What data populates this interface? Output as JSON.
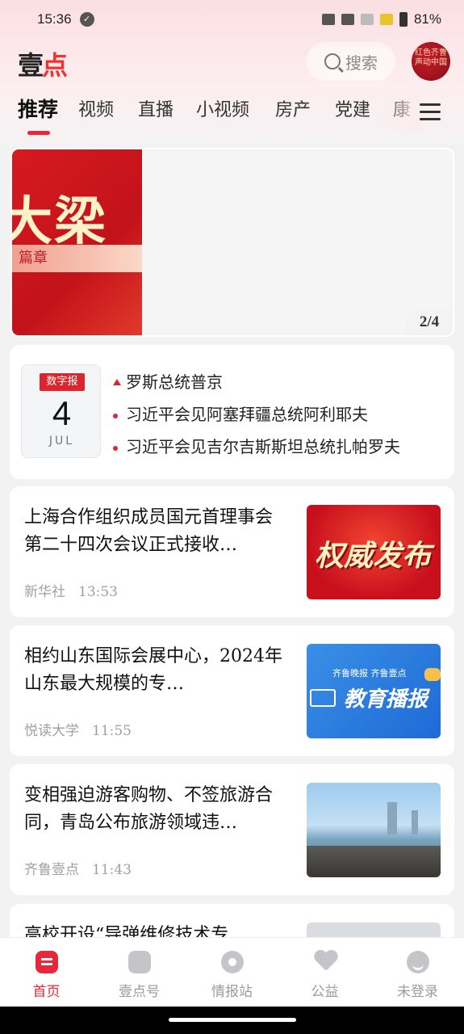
{
  "status_bar": {
    "time": "15:36",
    "battery": "81%"
  },
  "header": {
    "logo_main": "壹",
    "logo_dot": "点",
    "search_placeholder": "搜索",
    "avatar_text": "红色齐鲁 声动中国"
  },
  "tabs": [
    {
      "label": "推荐",
      "active": true
    },
    {
      "label": "视频"
    },
    {
      "label": "直播"
    },
    {
      "label": "小视频"
    },
    {
      "label": "房产"
    },
    {
      "label": "党建"
    },
    {
      "label": "康"
    }
  ],
  "banner": {
    "big_text": "大梁",
    "strip_text": "篇章",
    "counter": "2/4"
  },
  "digital_paper": {
    "label": "数字报",
    "day": "4",
    "month": "JUL",
    "headlines": [
      "罗斯总统普京",
      "习近平会见阿塞拜疆总统阿利耶夫",
      "习近平会见吉尔吉斯斯坦总统扎帕罗夫"
    ]
  },
  "news": [
    {
      "title": "上海合作组织成员国元首理事会第二十四次会议正式接收…",
      "source": "新华社",
      "time": "13:53",
      "thumb_text": "权威发布"
    },
    {
      "title": "相约山东国际会展中心，2024年山东最大规模的专…",
      "source": "悦读大学",
      "time": "11:55",
      "thumb_text": "教育播报",
      "thumb_top": "齐鲁晚报 齐鲁壹点"
    },
    {
      "title": "变相强迫游客购物、不签旅游合同，青岛公布旅游领域违…",
      "source": "齐鲁壹点",
      "time": "11:43"
    },
    {
      "title": "高校开设“导弹维修技术专"
    }
  ],
  "bottom_nav": [
    {
      "label": "首页",
      "icon": "home-icon",
      "active": true
    },
    {
      "label": "壹点号",
      "icon": "yidianhao-icon"
    },
    {
      "label": "情报站",
      "icon": "intel-station-icon"
    },
    {
      "label": "公益",
      "icon": "heart-icon"
    },
    {
      "label": "未登录",
      "icon": "user-face-icon"
    }
  ],
  "colors": {
    "accent": "#e8283a",
    "bg": "#f2f2f3"
  }
}
